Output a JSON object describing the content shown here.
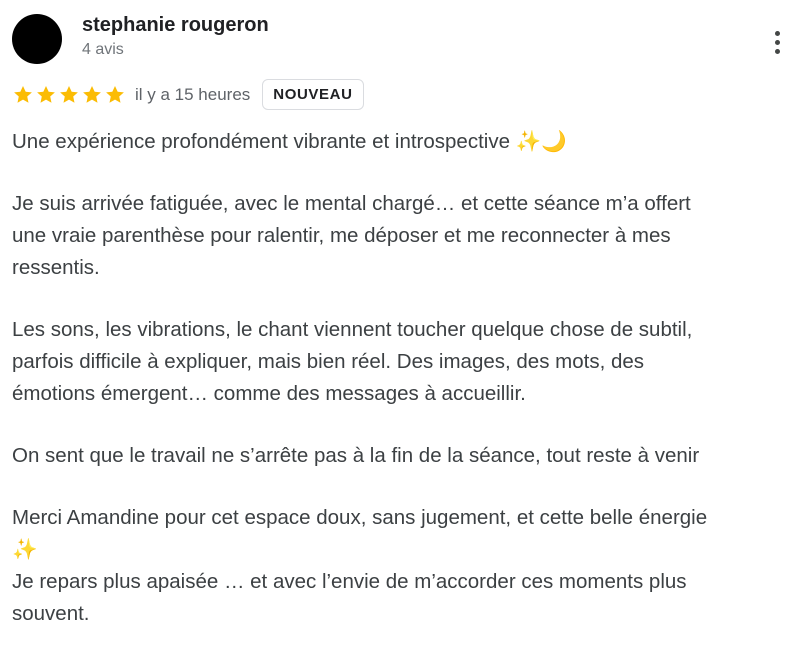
{
  "reviewer": {
    "name": "stephanie rougeron",
    "review_count": "4 avis"
  },
  "rating": {
    "stars": 5,
    "max_stars": 5,
    "star_color": "#fbbc04",
    "time_ago": "il y a 15 heures",
    "badge": "NOUVEAU"
  },
  "menu": {
    "icon": "more-vert-icon"
  },
  "review": {
    "p1": {
      "l1": "Une expérience profondément vibrante et introspective ",
      "e1": "✨",
      "e2": "🌙"
    },
    "p2": {
      "l1": "Je suis arrivée fatiguée, avec le mental chargé… et cette séance m’a offert",
      "l2": "une vraie parenthèse pour ralentir, me déposer et me reconnecter à mes",
      "l3": "ressentis."
    },
    "p3": {
      "l1": "Les sons, les vibrations, le chant viennent toucher quelque chose de subtil,",
      "l2": "parfois difficile à expliquer, mais bien réel. Des images, des mots, des",
      "l3": "émotions émergent… comme des messages à accueillir."
    },
    "p4": {
      "l1": "On sent que le travail ne s’arrête pas à la fin de la séance, tout reste à venir"
    },
    "p5": {
      "l1": "Merci Amandine pour cet espace doux, sans jugement, et cette belle énergie",
      "e1": "✨",
      "l2": "Je repars plus apaisée … et avec l’envie de m’accorder ces moments plus",
      "l3": "souvent."
    }
  }
}
